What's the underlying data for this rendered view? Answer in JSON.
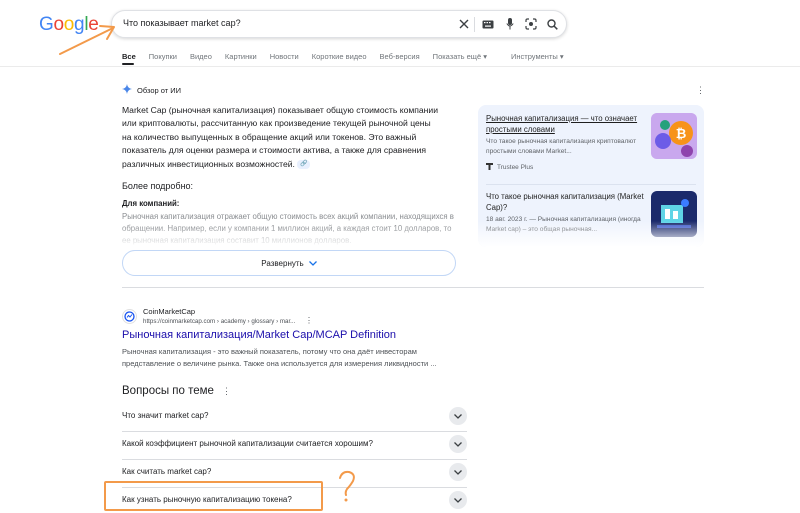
{
  "logo": {
    "letters": [
      "G",
      "o",
      "o",
      "g",
      "l",
      "e"
    ],
    "colors": [
      "#4285f4",
      "#ea4335",
      "#fbbc05",
      "#4285f4",
      "#34a853",
      "#ea4335"
    ]
  },
  "search": {
    "query": "Что показывает market cap?"
  },
  "tabs": [
    "Все",
    "Покупки",
    "Видео",
    "Картинки",
    "Новости",
    "Короткие видео",
    "Веб-версия",
    "Показать ещё ▾"
  ],
  "tools_label": "Инструменты ▾",
  "ai_overview": {
    "label": "Обзор от ИИ",
    "paragraph": "Market Cap (рыночная капитализация) показывает общую стоимость компании или криптовалюты, рассчитанную как произведение текущей рыночной цены на количество выпущенных в обращение акций или токенов. Это важный показатель для оценки размера и стоимости актива, а также для сравнения различных инвестиционных возможностей.",
    "more_label": "Более подробно:",
    "for_companies_label": "Для компаний:",
    "faded_text": "Рыночная капитализация отражает общую стоимость всех акций компании, находящихся в обращении. Например, если у компании 1 миллион акций, а каждая стоит 10 долларов, то ее рыночная капитализация составит 10 миллионов долларов.",
    "expand_label": "Развернуть"
  },
  "sources": [
    {
      "title": "Рыночная капитализация — что означает простыми словами",
      "snippet": "Что такое рыночная капитализация криптовалют простыми словами Market...",
      "site": "Trustee Plus"
    },
    {
      "title": "Что такое рыночная капитализация (Market Cap)?",
      "snippet": "18 авг. 2023 г. — Рыночная капитализация (иногда Market cap) – это общая рыночная..."
    }
  ],
  "result": {
    "site": "CoinMarketCap",
    "url": "https://coinmarketcap.com › academy › glossary › mar...",
    "title": "Рыночная капитализация/Market Cap/MCAP Definition",
    "snippet": "Рыночная капитализация - это важный показатель, потому что она даёт инвесторам представление о величине рынка. Также она используется для измерения ликвидности ..."
  },
  "paa": {
    "heading": "Вопросы по теме",
    "items": [
      "Что значит market cap?",
      "Какой коэффициент рыночной капитализации считается хорошим?",
      "Как считать market cap?",
      "Как узнать рыночную капитализацию токена?"
    ]
  },
  "annotation": {
    "color": "#f39a4a"
  }
}
